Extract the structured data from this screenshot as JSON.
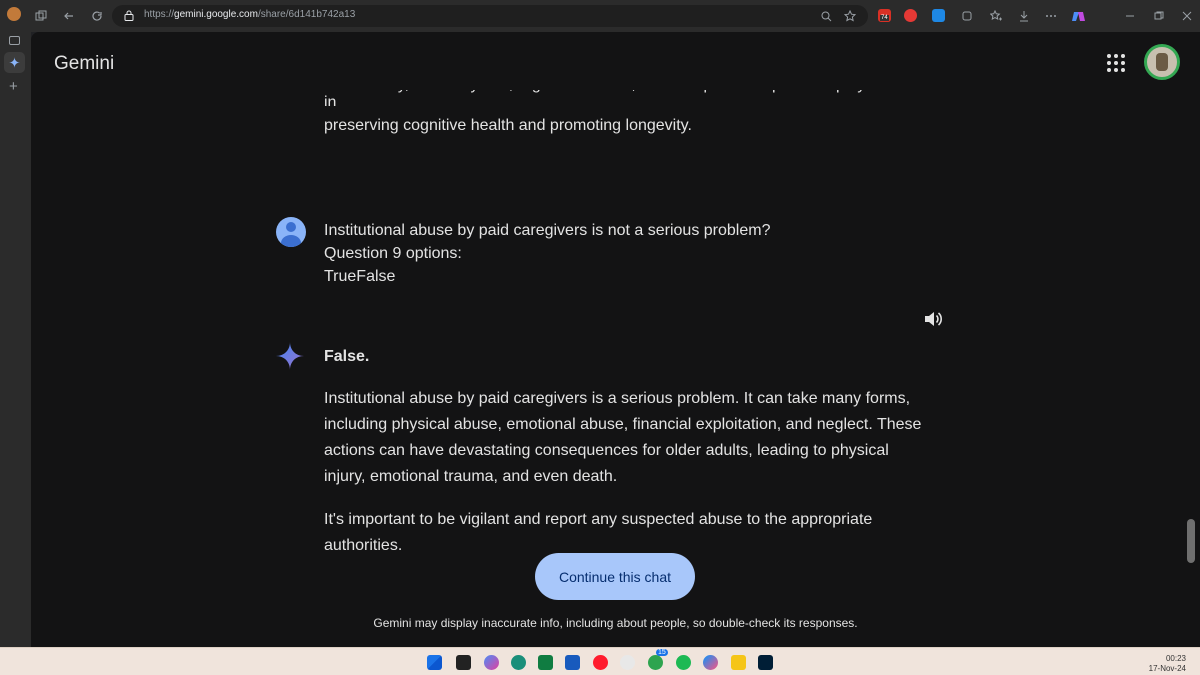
{
  "browser": {
    "url_prefix": "https://",
    "url_host": "gemini.google.com",
    "url_path": "/share/6d141b742a13",
    "badge_count": "74"
  },
  "header": {
    "brand": "Gemini"
  },
  "conversation": {
    "previous_tail": "Additionally, a healthy diet, regular exercise, and adequate sleep can all play a role in",
    "previous_last_line": "preserving cognitive health and promoting longevity.",
    "user_prompt": {
      "line1": "Institutional abuse by paid caregivers is not a serious problem?",
      "line2": "Question 9 options:",
      "line3": "TrueFalse"
    },
    "response": {
      "answer": "False.",
      "paragraph1": "Institutional abuse by paid caregivers is a serious problem. It can take many forms, including physical abuse, emotional abuse, financial exploitation, and neglect. These actions can have devastating consequences for older adults, leading to physical injury, emotional trauma, and even death.",
      "paragraph2": "It's important to be vigilant and report any suspected abuse to the appropriate authorities."
    }
  },
  "actions": {
    "continue_label": "Continue this chat"
  },
  "footer": {
    "disclaimer": "Gemini may display inaccurate info, including about people, so double-check its responses."
  },
  "taskbar": {
    "time": "00:23",
    "date": "17-Nov-24",
    "notification_badge": "15"
  },
  "colors": {
    "page_bg": "#131314",
    "text": "#e3e3e3",
    "button_bg": "#a8c7fa",
    "button_text": "#062e6f",
    "sparkle": "#4285f4"
  }
}
